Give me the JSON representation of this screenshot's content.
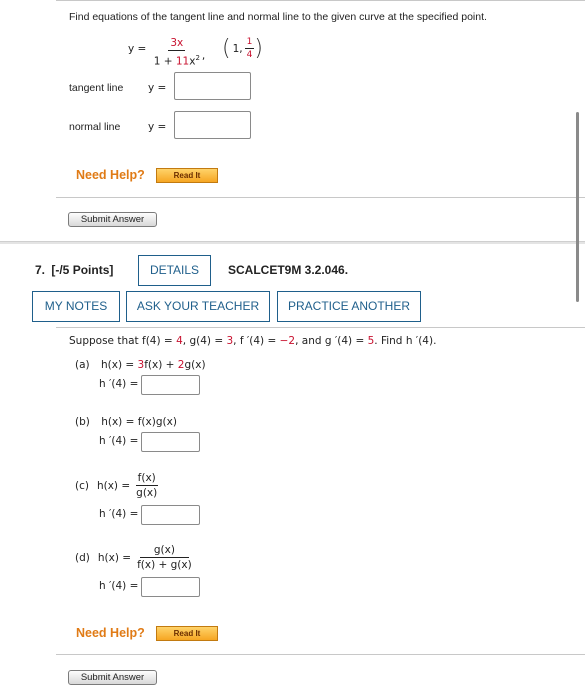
{
  "q6": {
    "prompt": "Find equations of the tangent line and normal line to the given curve at the specified point.",
    "eq_lhs": "y =",
    "eq_num": "3x",
    "eq_den_const": "1 + ",
    "eq_den_coef": "11",
    "eq_den_var": "x",
    "eq_den_exp": "2",
    "eq_comma": ",",
    "point_x": "1,",
    "point_num": "1",
    "point_den": "4",
    "tangent_label": "tangent line",
    "normal_label": "normal line",
    "y_eq": "y =",
    "tangent_value": "",
    "normal_value": "",
    "need_help": "Need Help?",
    "read_it": "Read It",
    "submit": "Submit Answer"
  },
  "q7": {
    "number": "7.",
    "points": "[-/5 Points]",
    "details": "DETAILS",
    "code": "SCALCET9M 3.2.046.",
    "my_notes": "MY NOTES",
    "ask_teacher": "ASK YOUR TEACHER",
    "practice_another": "PRACTICE ANOTHER",
    "stmt": {
      "s1": "Suppose that ",
      "f4": "f(4) = ",
      "v_f": "4",
      "c1": ", ",
      "g4": "g(4) = ",
      "v_g": "3",
      "c2": ", ",
      "fp4": "f ′(4) = ",
      "v_fp": "−2",
      "c3": ", and ",
      "gp4": "g ′(4) = ",
      "v_gp": "5",
      "c4": ". Find ",
      "hp": "h ′(4)",
      "c5": "."
    },
    "parts": {
      "a": {
        "label": "(a)",
        "lhs": "h(x) = ",
        "coef1": "3",
        "t1": "f(x) + ",
        "coef2": "2",
        "t2": "g(x)",
        "answer_label": "h ′(4) =",
        "value": ""
      },
      "b": {
        "label": "(b)",
        "lhs": "h(x) = f(x)g(x)",
        "answer_label": "h ′(4) =",
        "value": ""
      },
      "c": {
        "label": "(c)",
        "lhs": "h(x) =",
        "num": "f(x)",
        "den": "g(x)",
        "answer_label": "h ′(4) =",
        "value": ""
      },
      "d": {
        "label": "(d)",
        "lhs": "h(x) =",
        "num": "g(x)",
        "den": "f(x) + g(x)",
        "answer_label": "h ′(4) =",
        "value": ""
      }
    },
    "need_help": "Need Help?",
    "read_it": "Read It",
    "submit": "Submit Answer"
  }
}
